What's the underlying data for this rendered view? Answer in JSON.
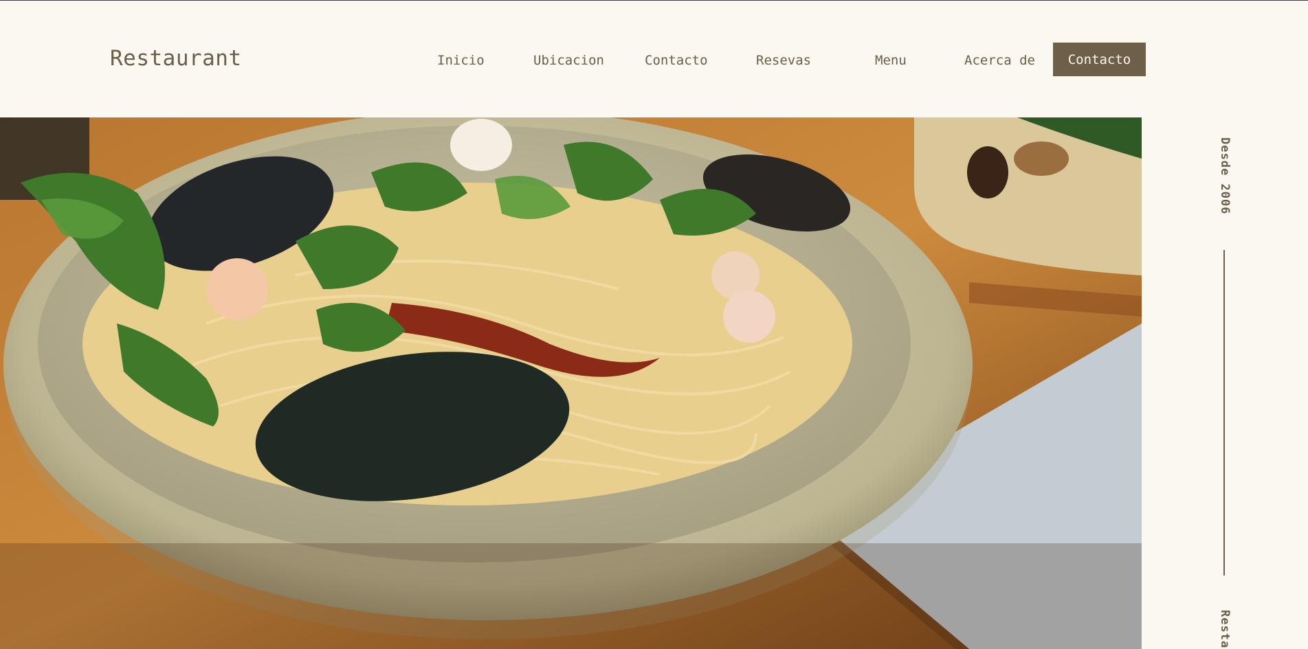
{
  "header": {
    "brand": "Restaurant",
    "nav": [
      "Inicio",
      "Ubicacion",
      "Contacto",
      "Resevas",
      "Menu",
      "Acerca de"
    ],
    "cta": "Contacto"
  },
  "hero": {
    "image": "seafood-spaghetti-photo"
  },
  "side": {
    "since": "Desde 2006",
    "brand": "Restaurant"
  },
  "colors": {
    "background": "#fbf8f1",
    "accent": "#6e6048",
    "text": "#6b5e4a"
  }
}
